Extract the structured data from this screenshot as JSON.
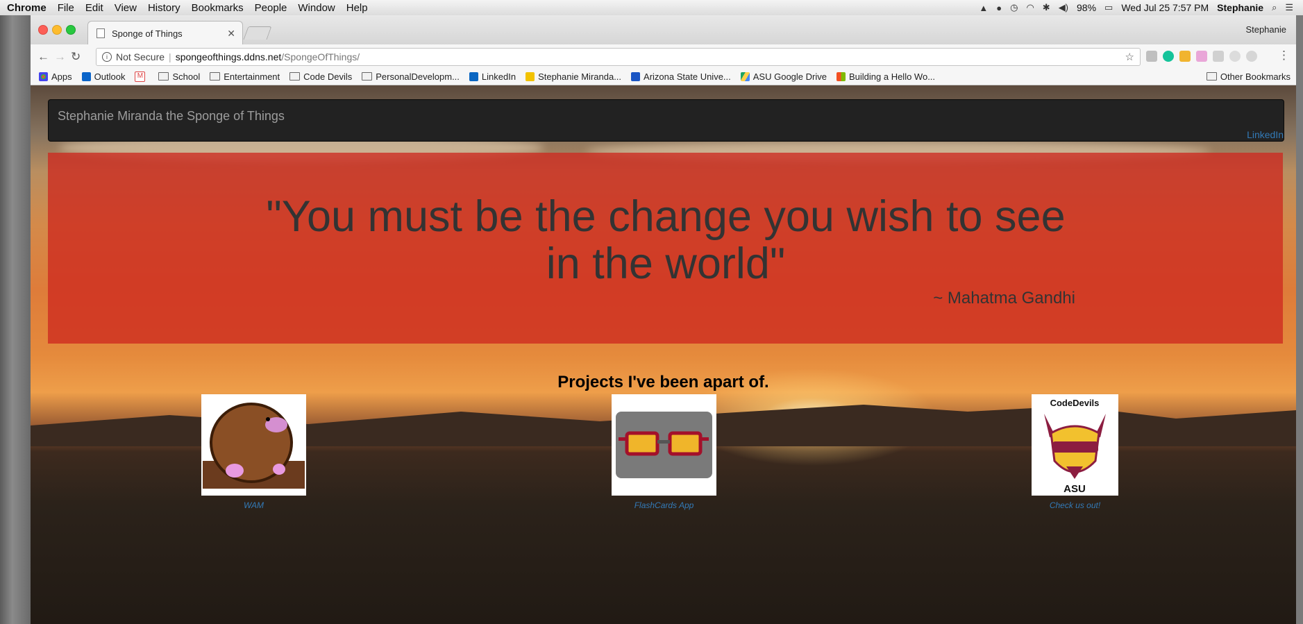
{
  "menubar": {
    "app": "Chrome",
    "menus": [
      "File",
      "Edit",
      "View",
      "History",
      "Bookmarks",
      "People",
      "Window",
      "Help"
    ],
    "battery": "98%",
    "datetime": "Wed Jul 25  7:57 PM",
    "user": "Stephanie"
  },
  "browser": {
    "tab_title": "Sponge of Things",
    "profile": "Stephanie",
    "url_security": "Not Secure",
    "url_host": "spongeofthings.ddns.net",
    "url_path": "/SpongeOfThings/",
    "bookmarks": [
      "Apps",
      "Outlook",
      "School",
      "Entertainment",
      "Code Devils",
      "PersonalDevelopm...",
      "LinkedIn",
      "Stephanie Miranda...",
      "Arizona State Unive...",
      "ASU Google Drive",
      "Building a Hello Wo..."
    ],
    "other_bookmarks": "Other Bookmarks"
  },
  "page": {
    "brand": "Stephanie Miranda the Sponge of Things",
    "nav_link": "LinkedIn",
    "quote": "\"You must be the change you wish to see in the world\"",
    "author": "~ Mahatma Gandhi",
    "projects_title": "Projects I've been apart of.",
    "projects": [
      {
        "caption": "WAM",
        "icon": "mole-icon"
      },
      {
        "caption": "FlashCards App",
        "icon": "sunglasses-icon"
      },
      {
        "caption": "Check us out!",
        "icon": "codedevils-logo",
        "logo_text_top": "CodeDevils",
        "logo_text_bottom": "ASU"
      }
    ]
  }
}
